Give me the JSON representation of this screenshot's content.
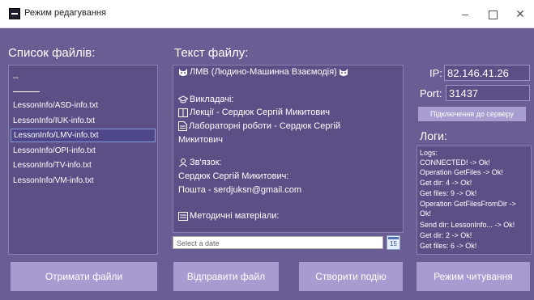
{
  "window": {
    "title": "Режим редагування",
    "minimize": "–",
    "close": "✕"
  },
  "files": {
    "heading": "Список файлів:",
    "dash": "--",
    "items": [
      "LessonInfo/ASD-info.txt",
      "LessonInfo/IUK-info.txt",
      "LessonInfo/LMV-info.txt",
      "LessonInfo/OPI-info.txt",
      "LessonInfo/TV-info.txt",
      "LessonInfo/VM-info.txt"
    ],
    "selected_index": 2
  },
  "text": {
    "heading": "Текст файлу:",
    "lines": [
      "ЛМВ (Людино-Машинна Взаємодія)",
      "",
      "Викладачі:",
      "Лекції - Сердюк Сергій Микитович",
      "Лабораторні роботи - Сердюк Сергій",
      "Микитович",
      "",
      "Зв'язок:",
      "Сердюк Сергій Микитович:",
      "Пошта - serdjuksn@gmail.com",
      "",
      "Методичні матеріали:"
    ]
  },
  "date": {
    "placeholder": "Select a date",
    "calendar_day": "15"
  },
  "connection": {
    "ip_label": "IP:",
    "ip_value": "82.146.41.26",
    "port_label": "Port:",
    "port_value": "31437",
    "connect_label": "Підключення до серверу"
  },
  "logs": {
    "heading": "Логи:",
    "lines": [
      "Logs:",
      "CONNECTED!  -> Ok!",
      "Operation GetFiles  -> Ok!",
      "Get dir: 4  -> Ok!",
      "Get files: 9  -> Ok!",
      "Operation GetFilesFromDir  ->",
      "Ok!",
      "Send dir: LessonInfo...  -> Ok!",
      "Get dir: 2  -> Ok!",
      "Get files: 6  -> Ok!"
    ]
  },
  "buttons": {
    "get_files": "Отримати файли",
    "send_file": "Відправити файл",
    "create_event": "Створити подію",
    "read_mode": "Режим читування"
  }
}
